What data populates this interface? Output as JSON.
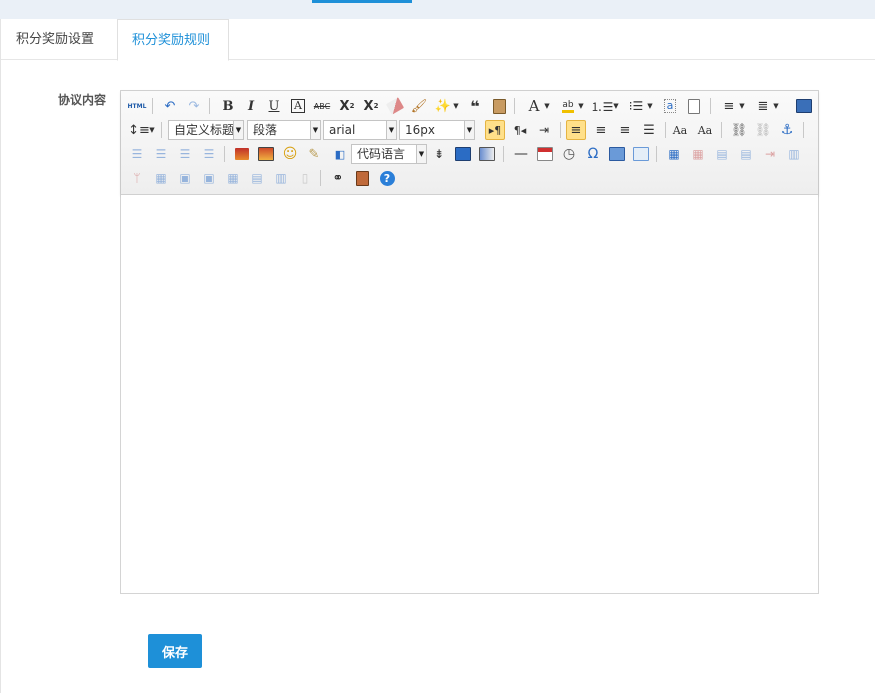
{
  "tabs": [
    {
      "label": "积分奖励设置",
      "active": false
    },
    {
      "label": "积分奖励规则",
      "active": true
    }
  ],
  "form": {
    "content_label": "协议内容",
    "content_value": "",
    "save_label": "保存"
  },
  "toolbar": {
    "html_label": "HTML",
    "heading_dropdown": "自定义标题",
    "paragraph_dropdown": "段落",
    "font_dropdown": "arial",
    "fontsize_dropdown": "16px",
    "code_language_dropdown": "代码语言",
    "icons": {
      "undo": "undo-icon",
      "redo": "redo-icon",
      "bold": "bold-icon",
      "italic": "italic-icon",
      "underline": "underline-icon",
      "help": "help-icon",
      "search": "search-replace-icon"
    }
  },
  "colors": {
    "accent": "#1e90d8",
    "active_button_bg": "#ffe08a",
    "page_bg": "#ffffff",
    "top_strip": "#eaf0f7"
  }
}
